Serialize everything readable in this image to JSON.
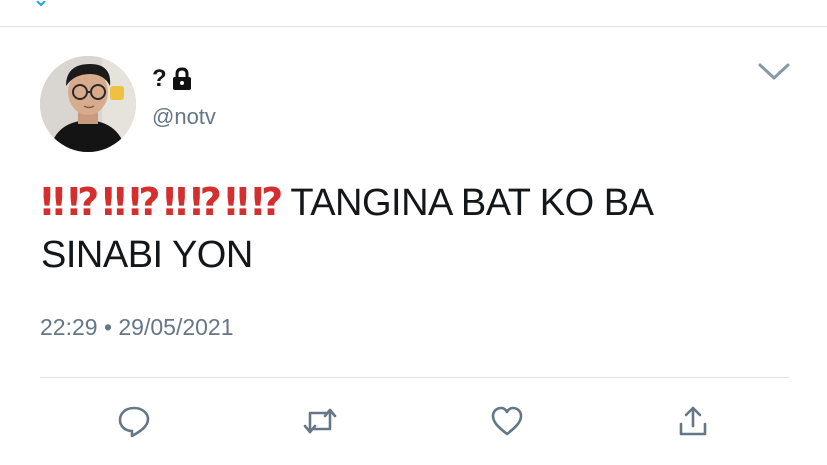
{
  "tweet": {
    "author_name": "?",
    "author_handle": "@notv",
    "marks": [
      "‼",
      "⁉",
      "‼",
      "⁉",
      "‼",
      "⁉",
      "‼",
      "⁉"
    ],
    "text_line": "TANGINA BAT KO BA SINABI YON",
    "timestamp": "22:29 • 29/05/2021"
  },
  "colors": {
    "accent": "#1da1f2",
    "mark_red": "#d32f2f",
    "secondary_text": "#657786",
    "icon_gray": "#657786",
    "divider": "#dfe3e6"
  },
  "icons": {
    "lock": "lock-icon",
    "menu": "chevron-down-icon",
    "reply": "reply-icon",
    "retweet": "retweet-icon",
    "like": "heart-icon",
    "share": "share-icon"
  }
}
